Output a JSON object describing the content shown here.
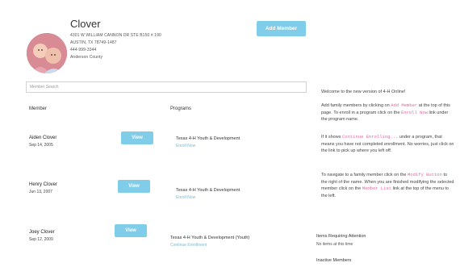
{
  "family": {
    "name": "Clover",
    "address_line1": "4301 W WILLIAM CANNON DR STE B150 # 190",
    "address_line2": "AUSTIN, TX 78749-1487",
    "phone": "444-999-3344",
    "county": "Anderson County"
  },
  "actions": {
    "add_member_label": "Add Member"
  },
  "search": {
    "placeholder": "Member Search"
  },
  "table": {
    "member_header": "Member",
    "programs_header": "Programs"
  },
  "members": [
    {
      "name": "Aiden Clover",
      "dob": "Sep 14, 2005",
      "view_label": "View",
      "program": "Texas 4-H Youth & Development",
      "link": "Enroll Now"
    },
    {
      "name": "Henry Clover",
      "dob": "Jun 13, 2007",
      "view_label": "View",
      "program": "Texas 4-H Youth & Development",
      "link": "Enroll Now"
    },
    {
      "name": "Joey Clover",
      "dob": "Sep 12, 2009",
      "view_label": "View",
      "program": "Texas 4-H Youth & Development (Youth)",
      "link": "Continue Enrollment"
    }
  ],
  "info": {
    "welcome": "Welcome to the new version of 4-H Online!",
    "p1_a": "Add family members by clicking on ",
    "p1_kw": "Add Member",
    "p1_b": " at the top of this page. To enroll in a program click on the ",
    "p1_kw2": "Enroll Now",
    "p1_c": " link under the program name.",
    "p2_a": "If it shows ",
    "p2_kw": "Continue Enrolling...",
    "p2_b": " under a program, that means you have not completed enrollment. No worries, just click on the link to pick up where you left off.",
    "p3_a": "To navigate to a family member click on the ",
    "p3_kw": "Modify Button",
    "p3_b": " to the right of the name. When you are finished modifying the selected member click on the ",
    "p3_kw2": "Member List",
    "p3_c": " link at the top of the menu to the left.",
    "attention_header": "Items Requiring Attention",
    "attention_text": "No items at this time",
    "inactive_header": "Inactive Members"
  }
}
